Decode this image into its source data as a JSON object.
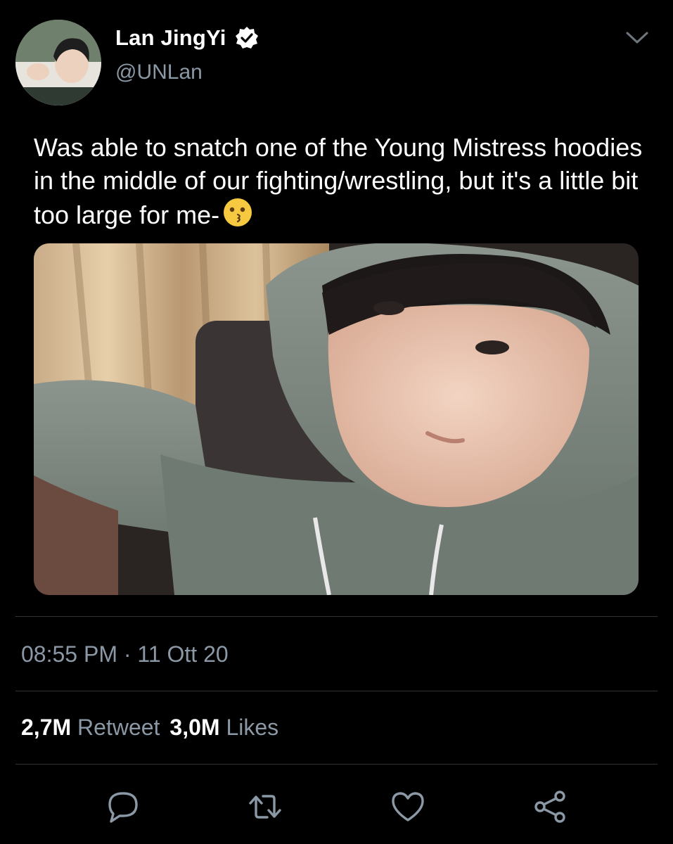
{
  "header": {
    "display_name": "Lan JingYi",
    "handle": "@UNLan",
    "verified_icon": "verified-badge-icon",
    "menu_icon": "chevron-down-icon"
  },
  "tweet": {
    "text": "Was able to snatch one of the Young Mistress hoodies in the middle of our fighting/wrestling, but it's a little bit too large for me-",
    "emoji": "kissing-face-emoji"
  },
  "meta": {
    "time": "08:55 PM",
    "separator": "·",
    "date": "11 Ott 20"
  },
  "stats": {
    "retweets_count": "2,7M",
    "retweets_label": "Retweet",
    "likes_count": "3,0M",
    "likes_label": "Likes"
  },
  "actions": [
    "reply-icon",
    "retweet-icon",
    "like-icon",
    "share-icon"
  ],
  "colors": {
    "background": "#000000",
    "text_primary": "#ffffff",
    "text_secondary": "#8b98a5",
    "divider": "#2f3336"
  }
}
